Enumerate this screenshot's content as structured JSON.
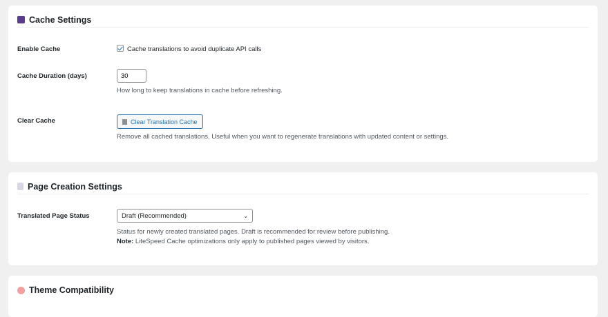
{
  "cache": {
    "title": "Cache Settings",
    "enable_label": "Enable Cache",
    "enable_text": "Cache translations to avoid duplicate API calls",
    "enable_checked": true,
    "duration_label": "Cache Duration (days)",
    "duration_value": "30",
    "duration_desc": "How long to keep translations in cache before refreshing.",
    "clear_label": "Clear Cache",
    "clear_button": "Clear Translation Cache",
    "clear_desc": "Remove all cached translations. Useful when you want to regenerate translations with updated content or settings."
  },
  "page": {
    "title": "Page Creation Settings",
    "status_label": "Translated Page Status",
    "status_value": "Draft (Recommended)",
    "status_desc": "Status for newly created translated pages. Draft is recommended for review before publishing.",
    "note_label": "Note:",
    "note_text": " LiteSpeed Cache optimizations only apply to published pages viewed by visitors."
  },
  "theme": {
    "title": "Theme Compatibility"
  }
}
